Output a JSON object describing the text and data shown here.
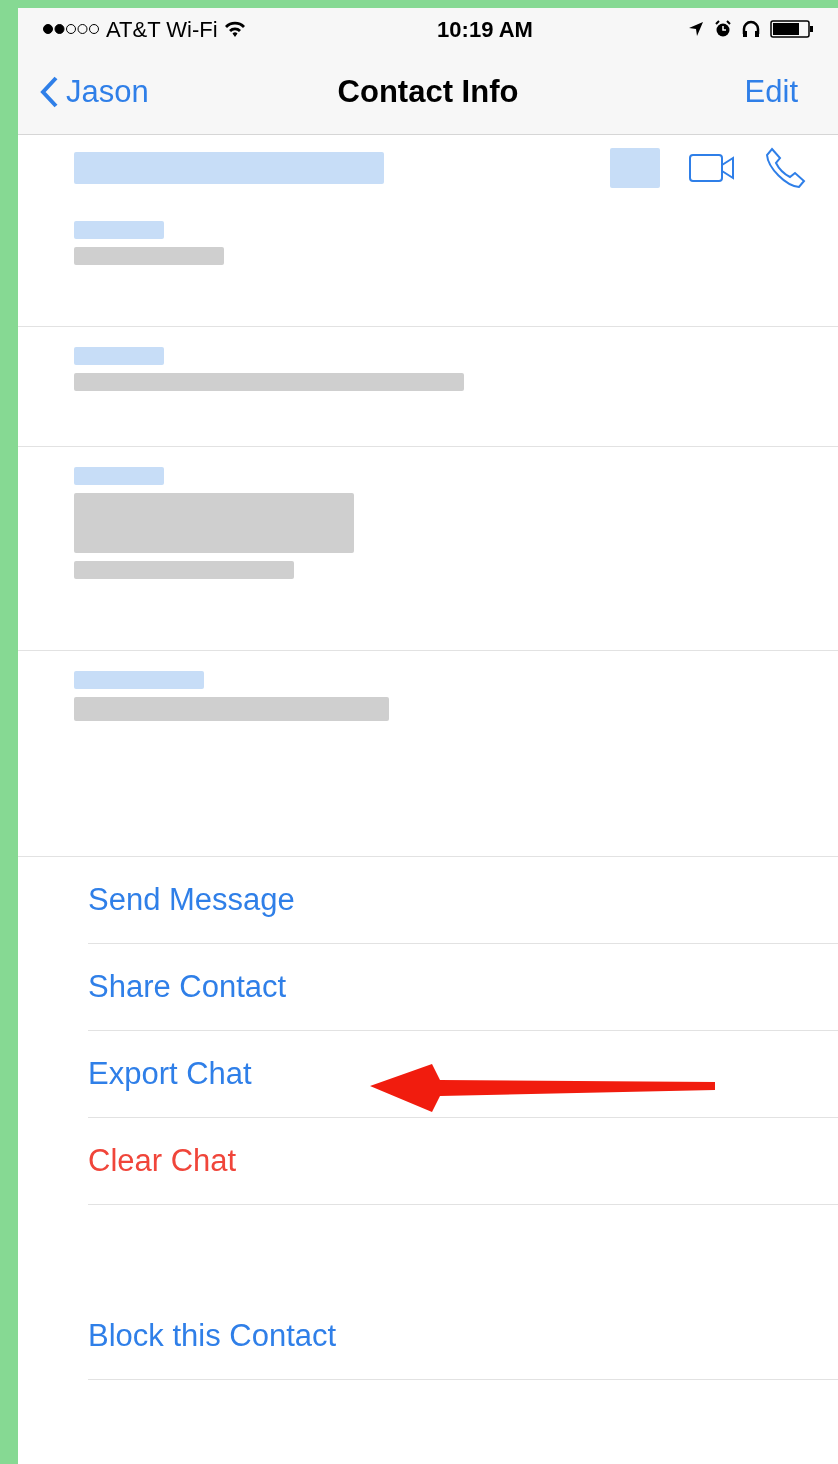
{
  "status_bar": {
    "carrier": "AT&T Wi-Fi",
    "time": "10:19 AM"
  },
  "nav_bar": {
    "back": "Jason",
    "title": "Contact Info",
    "action": "Edit"
  },
  "action_groups": [
    {
      "items": [
        {
          "label": "Send Message",
          "kind": "normal"
        },
        {
          "label": "Share Contact",
          "kind": "normal"
        },
        {
          "label": "Export Chat",
          "kind": "normal"
        },
        {
          "label": "Clear Chat",
          "kind": "destructive"
        }
      ]
    },
    {
      "items": [
        {
          "label": "Block this Contact",
          "kind": "normal"
        }
      ]
    }
  ]
}
